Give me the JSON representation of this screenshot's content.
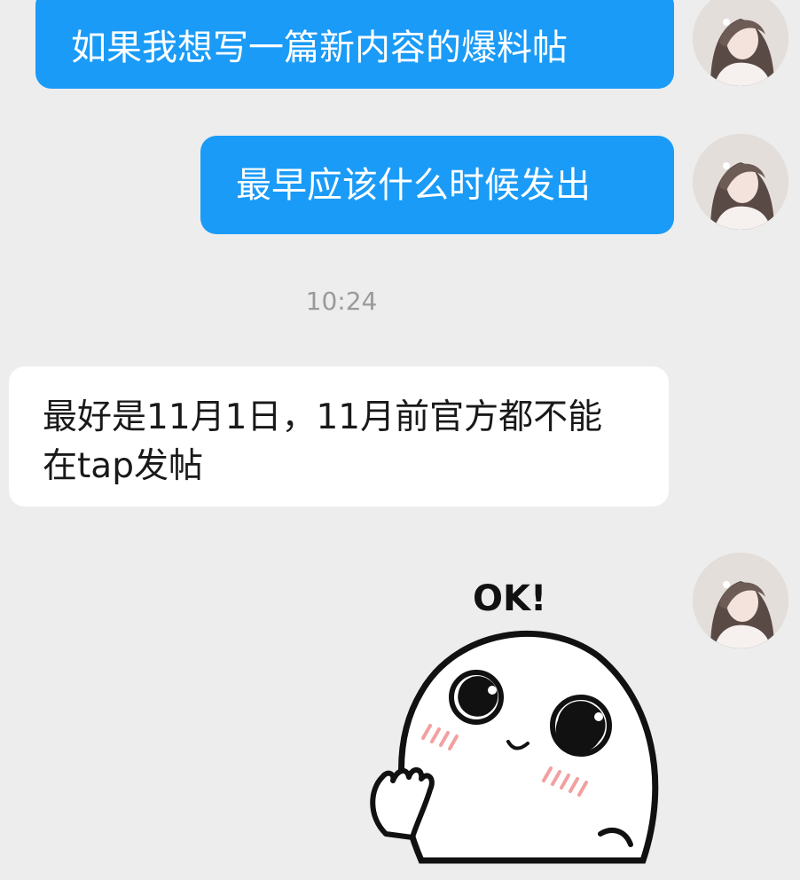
{
  "messages": [
    {
      "sender": "self",
      "text": "如果我想写一篇新内容的爆料帖"
    },
    {
      "sender": "self",
      "text": "最早应该什么时候发出"
    },
    {
      "sender": "other",
      "text": "最好是11月1日，11月前官方都不能在tap发帖"
    }
  ],
  "timestamp": "10:24",
  "sticker": {
    "text": "OK!",
    "icon": "waving-smiley-sticker"
  },
  "colors": {
    "outgoing_bubble": "#1a9bf7",
    "incoming_bubble": "#ffffff",
    "background": "#ededed"
  }
}
